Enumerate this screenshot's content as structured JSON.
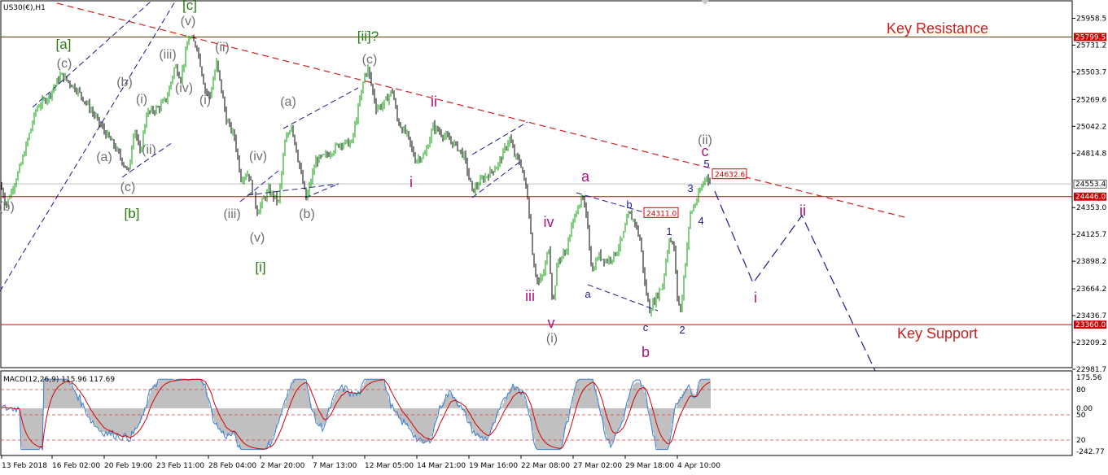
{
  "symbol_info": "US30(€),H1",
  "indicator_info": "MACD(12,26,9) 115.96 117.69",
  "colors": {
    "up_candle": "#00a000",
    "down_candle": "#000000",
    "level_line": "#d00000",
    "resistance_text": "#cc2020",
    "wave_gray": "#707070",
    "wave_green": "#2a7a12",
    "wave_magenta": "#b0127e",
    "wave_navy": "#1a1a8c",
    "macd_hist": "#c0c0c0",
    "macd_line": "#3a7fd6",
    "signal_line": "#d00000"
  },
  "chart_data": {
    "type": "candlestick",
    "price_axis": {
      "ylim": [
        22900,
        26050
      ],
      "ticks": [
        "25958.5",
        "25731.2",
        "25503.7",
        "25269.6",
        "25042.2",
        "24814.8",
        "24353.0",
        "24125.7",
        "23898.2",
        "23664.2",
        "23436.7",
        "23209.2",
        "22981.7"
      ]
    },
    "time_axis": {
      "ticks": [
        "13 Feb 2018",
        "16 Feb 02:00",
        "20 Feb 19:00",
        "23 Feb 11:00",
        "28 Feb 04:00",
        "2 Mar 20:00",
        "7 Mar 13:00",
        "12 Mar 05:00",
        "14 Mar 21:00",
        "19 Mar 16:00",
        "22 Mar 08:00",
        "27 Mar 02:00",
        "29 Mar 18:00",
        "4 Apr 10:00"
      ]
    },
    "price_path": [
      [
        0,
        24550
      ],
      [
        8,
        24380
      ],
      [
        25,
        24700
      ],
      [
        45,
        25200
      ],
      [
        60,
        25300
      ],
      [
        75,
        25480
      ],
      [
        95,
        25350
      ],
      [
        110,
        25200
      ],
      [
        128,
        25000
      ],
      [
        140,
        24880
      ],
      [
        150,
        24750
      ],
      [
        158,
        24650
      ],
      [
        165,
        25050
      ],
      [
        172,
        24800
      ],
      [
        180,
        25150
      ],
      [
        195,
        25200
      ],
      [
        205,
        25280
      ],
      [
        215,
        25560
      ],
      [
        222,
        25450
      ],
      [
        232,
        25800
      ],
      [
        242,
        25720
      ],
      [
        252,
        25350
      ],
      [
        258,
        25300
      ],
      [
        266,
        25580
      ],
      [
        272,
        25350
      ],
      [
        278,
        25100
      ],
      [
        288,
        24950
      ],
      [
        296,
        24600
      ],
      [
        305,
        24650
      ],
      [
        316,
        24320
      ],
      [
        330,
        24500
      ],
      [
        342,
        24400
      ],
      [
        350,
        24900
      ],
      [
        358,
        25060
      ],
      [
        368,
        24700
      ],
      [
        376,
        24420
      ],
      [
        388,
        24750
      ],
      [
        402,
        24800
      ],
      [
        418,
        24900
      ],
      [
        432,
        24900
      ],
      [
        448,
        25480
      ],
      [
        452,
        25530
      ],
      [
        462,
        25200
      ],
      [
        470,
        25220
      ],
      [
        482,
        25350
      ],
      [
        488,
        25100
      ],
      [
        494,
        25020
      ],
      [
        500,
        24970
      ],
      [
        510,
        24760
      ],
      [
        522,
        24800
      ],
      [
        532,
        25040
      ],
      [
        548,
        24950
      ],
      [
        560,
        24880
      ],
      [
        570,
        24790
      ],
      [
        580,
        24490
      ],
      [
        592,
        24590
      ],
      [
        602,
        24650
      ],
      [
        612,
        24720
      ],
      [
        626,
        24940
      ],
      [
        632,
        24800
      ],
      [
        640,
        24720
      ],
      [
        648,
        24450
      ],
      [
        655,
        23900
      ],
      [
        661,
        23700
      ],
      [
        668,
        23800
      ],
      [
        674,
        24020
      ],
      [
        679,
        23520
      ],
      [
        685,
        23900
      ],
      [
        695,
        23980
      ],
      [
        702,
        24180
      ],
      [
        710,
        24380
      ],
      [
        716,
        24420
      ],
      [
        722,
        24200
      ],
      [
        727,
        23800
      ],
      [
        735,
        23950
      ],
      [
        745,
        23900
      ],
      [
        755,
        23950
      ],
      [
        765,
        24100
      ],
      [
        772,
        24300
      ],
      [
        780,
        24230
      ],
      [
        787,
        24050
      ],
      [
        792,
        23700
      ],
      [
        798,
        23480
      ],
      [
        805,
        23580
      ],
      [
        814,
        23700
      ],
      [
        822,
        24100
      ],
      [
        828,
        24000
      ],
      [
        832,
        23600
      ],
      [
        836,
        23470
      ],
      [
        842,
        23900
      ],
      [
        848,
        24300
      ],
      [
        856,
        24420
      ],
      [
        862,
        24530
      ],
      [
        868,
        24630
      ],
      [
        872,
        24560
      ]
    ],
    "horizontal_levels": [
      {
        "label": "25799.5",
        "value": 25799.5
      },
      {
        "label": "24446.0",
        "value": 24446.0
      },
      {
        "label": "23360.0",
        "value": 23360.0
      }
    ],
    "current_price": {
      "label": "24553.4",
      "value": 24553.4
    },
    "price_tags": [
      {
        "label": "24311.0",
        "value": 24311.0
      },
      {
        "label": "24632.6",
        "value": 24632.6
      }
    ],
    "zones": [
      {
        "label": "Key Resistance"
      },
      {
        "label": "Key Support"
      }
    ],
    "wave_labels": {
      "gray": [
        "(b)",
        "(c)",
        "(a)",
        "(b)",
        "(i)",
        "(ii)",
        "(c)",
        "(v)",
        "(iii)",
        "(iv)",
        "(ii)",
        "(i)",
        "(iii)",
        "(iv)",
        "(v)",
        "(a)",
        "(b)",
        "(c)",
        "(i)",
        "(ii)"
      ],
      "green": [
        "[a]",
        "[b]",
        "[c]",
        "[i]",
        "[ii]?"
      ],
      "magenta": [
        "ii",
        "i",
        "iii",
        "iv",
        "v",
        "a",
        "b",
        "c",
        "ii",
        "i"
      ],
      "navy": [
        "a",
        "b",
        "c",
        "1",
        "2",
        "3",
        "4",
        "5"
      ]
    },
    "macd": {
      "name": "MACD(12,26,9)",
      "macd_value": 115.96,
      "signal_value": 117.69,
      "ticks": [
        "175.56",
        "0.00",
        "-242.77"
      ],
      "level_ticks": [
        "80",
        "50",
        "20"
      ]
    }
  }
}
